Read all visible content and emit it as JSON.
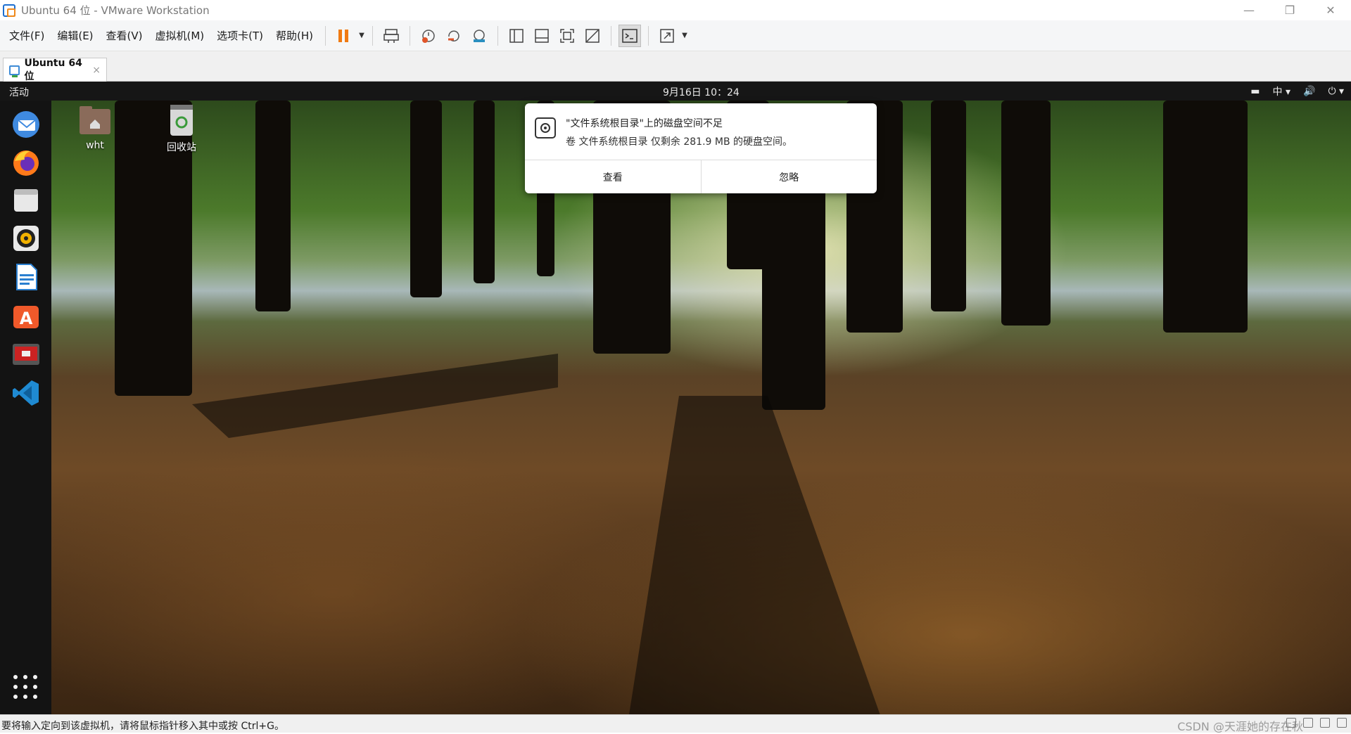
{
  "window": {
    "title": "Ubuntu 64 位 - VMware Workstation",
    "controls": {
      "minimize": "—",
      "restore": "❐",
      "close": "✕"
    }
  },
  "menu": {
    "items": [
      "文件(F)",
      "编辑(E)",
      "查看(V)",
      "虚拟机(M)",
      "选项卡(T)",
      "帮助(H)"
    ]
  },
  "toolbar": {
    "icons": [
      "pause-icon",
      "send-ctrl-alt-del-icon",
      "snapshot-icon",
      "revert-snapshot-icon",
      "snapshot-manager-icon",
      "show-library-icon",
      "thumbnail-bar-icon",
      "full-screen-icon",
      "unity-icon",
      "console-view-icon",
      "stretch-icon"
    ]
  },
  "tab": {
    "label": "Ubuntu 64 位",
    "close": "×"
  },
  "guest": {
    "activities": "活动",
    "clock": "9月16日  10：24",
    "input_method": "中",
    "dock_apps": [
      "thunderbird-icon",
      "firefox-icon",
      "files-icon",
      "rhythmbox-icon",
      "libreoffice-writer-icon",
      "ubuntu-software-icon",
      "screenshot-app-icon",
      "vscode-icon"
    ],
    "desktop_icons": [
      {
        "label": "wht",
        "icon": "home-folder-icon"
      },
      {
        "label": "回收站",
        "icon": "trash-icon"
      }
    ],
    "notification": {
      "title": "\"文件系统根目录\"上的磁盘空间不足",
      "body": "卷 文件系统根目录 仅剩余 281.9 MB 的硬盘空间。",
      "action_view": "查看",
      "action_ignore": "忽略"
    }
  },
  "statusbar": {
    "hint": "要将输入定向到该虚拟机，请将鼠标指针移入其中或按 Ctrl+G。",
    "watermark": "CSDN @天涯她的存在秋"
  }
}
